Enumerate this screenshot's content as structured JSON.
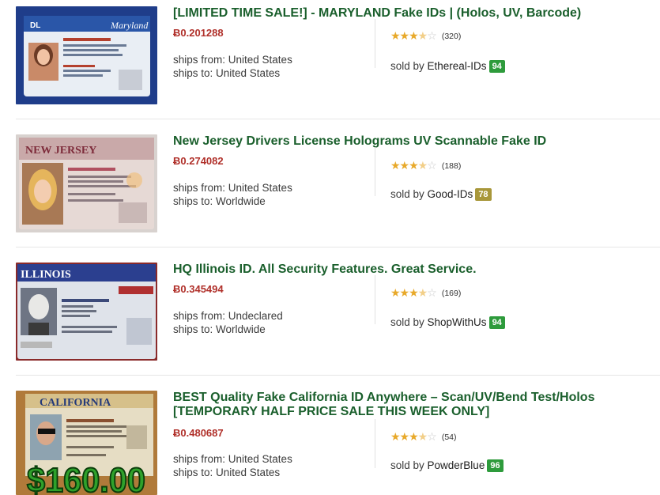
{
  "listings": [
    {
      "title": "[LIMITED TIME SALE!] - MARYLAND Fake IDs | (Holos, UV, Barcode)",
      "price": "Ƀ0.201288",
      "ships_from": "ships from: United States",
      "ships_to": "ships to: United States",
      "rating": 3.5,
      "review_count": "(320)",
      "sold_by_prefix": "sold by ",
      "vendor": "Ethereal-IDs",
      "vendor_score": "94",
      "badge_color": "#2e9b3c",
      "image": {
        "state": "Maryland",
        "dl": "DL"
      }
    },
    {
      "title": "New Jersey Drivers License Holograms UV Scannable Fake ID",
      "price": "Ƀ0.274082",
      "ships_from": "ships from: United States",
      "ships_to": "ships to: Worldwide",
      "rating": 3.5,
      "review_count": "(188)",
      "sold_by_prefix": "sold by ",
      "vendor": "Good-IDs",
      "vendor_score": "78",
      "badge_color": "#a8973a",
      "image": {
        "state": "NEW JERSEY"
      }
    },
    {
      "title": "HQ Illinois ID. All Security Features. Great Service.",
      "price": "Ƀ0.345494",
      "ships_from": "ships from: Undeclared",
      "ships_to": "ships to: Worldwide",
      "rating": 3.5,
      "review_count": "(169)",
      "sold_by_prefix": "sold by ",
      "vendor": "ShopWithUs",
      "vendor_score": "94",
      "badge_color": "#2e9b3c",
      "image": {
        "state": "ILLINOIS"
      }
    },
    {
      "title": "BEST Quality Fake California ID Anywhere – Scan/UV/Bend Test/Holos [TEMPORARY HALF PRICE SALE THIS WEEK ONLY]",
      "price": "Ƀ0.480687",
      "ships_from": "ships from: United States",
      "ships_to": "ships to: United States",
      "rating": 3.5,
      "review_count": "(54)",
      "sold_by_prefix": "sold by ",
      "vendor": "PowderBlue",
      "vendor_score": "96",
      "badge_color": "#2e9b3c",
      "image": {
        "state": "CALIFORNIA",
        "price_overlay": "$160.00"
      }
    }
  ]
}
